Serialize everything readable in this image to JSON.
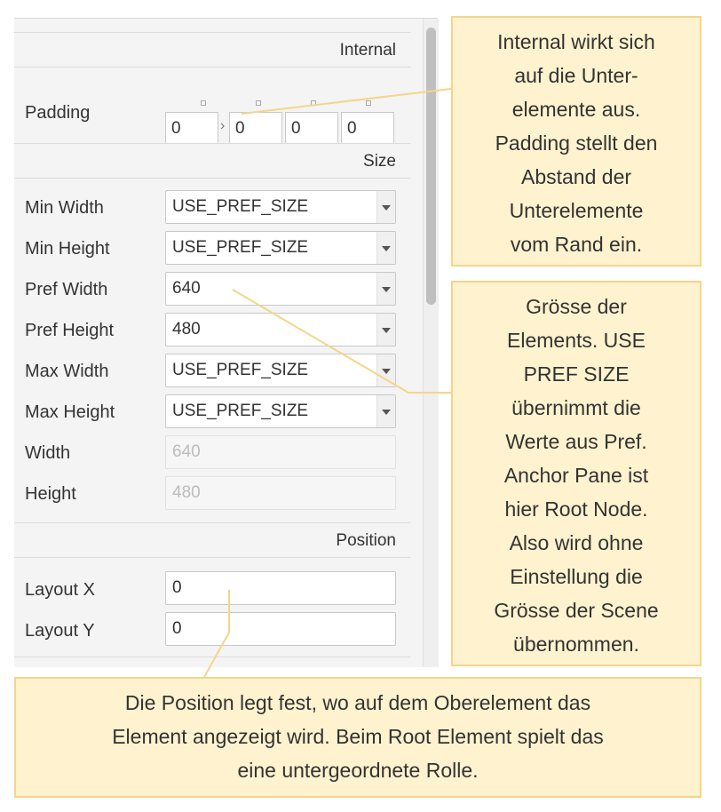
{
  "panel": {
    "sections": {
      "internal": "Internal",
      "size": "Size",
      "position": "Position"
    },
    "padding": {
      "label": "Padding",
      "values": [
        "0",
        "0",
        "0",
        "0"
      ],
      "separator": "›"
    },
    "size_rows": [
      {
        "label": "Min Width",
        "value": "USE_PREF_SIZE",
        "type": "combo"
      },
      {
        "label": "Min Height",
        "value": "USE_PREF_SIZE",
        "type": "combo"
      },
      {
        "label": "Pref Width",
        "value": "640",
        "type": "combo"
      },
      {
        "label": "Pref Height",
        "value": "480",
        "type": "combo"
      },
      {
        "label": "Max Width",
        "value": "USE_PREF_SIZE",
        "type": "combo"
      },
      {
        "label": "Max Height",
        "value": "USE_PREF_SIZE",
        "type": "combo"
      },
      {
        "label": "Width",
        "value": "640",
        "type": "readonly"
      },
      {
        "label": "Height",
        "value": "480",
        "type": "readonly"
      }
    ],
    "position_rows": [
      {
        "label": "Layout X",
        "value": "0"
      },
      {
        "label": "Layout Y",
        "value": "0"
      }
    ]
  },
  "notes": {
    "internal": [
      "Internal wirkt sich",
      "auf die Unter-",
      "elemente aus.",
      "Padding stellt den",
      "Abstand der",
      "Unterelemente",
      "vom Rand ein."
    ],
    "size": [
      "Grösse der",
      "Elements. USE",
      "PREF SIZE",
      "übernimmt die",
      "Werte aus Pref.",
      "Anchor Pane ist",
      "hier Root Node.",
      "Also wird ohne",
      "Einstellung die",
      "Grösse der Scene",
      "übernommen."
    ],
    "position": [
      "Die Position legt fest, wo auf dem Oberelement das",
      "Element angezeigt wird. Beim Root Element spielt das",
      "eine untergeordnete Rolle."
    ]
  },
  "colors": {
    "note_bg": "#fff3cf",
    "note_border": "#f4d58a",
    "line": "#f4d58a"
  }
}
